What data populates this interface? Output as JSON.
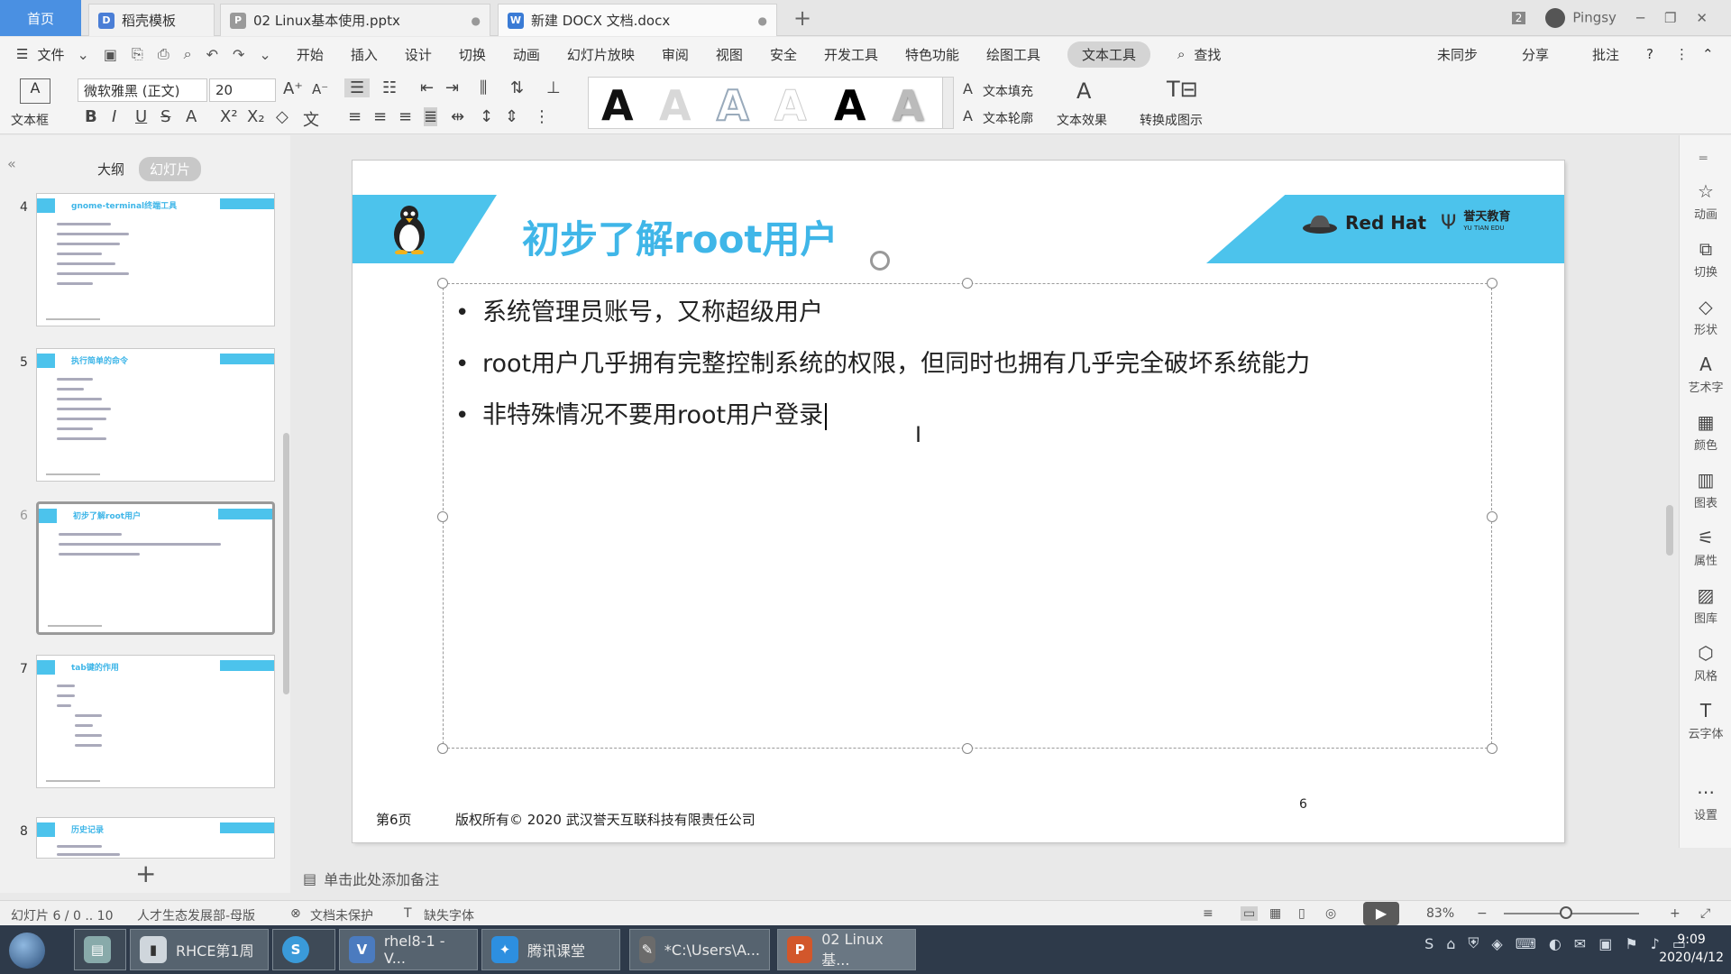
{
  "tabs": {
    "home": "首页",
    "items": [
      {
        "label": "稻壳模板",
        "icon": "docer-icon",
        "color": "#4a7ed6"
      },
      {
        "label": "02 Linux基本使用.pptx",
        "icon": "pptx-icon",
        "color": "#9a9a9a"
      },
      {
        "label": "新建 DOCX 文档.docx",
        "icon": "docx-icon",
        "color": "#3a7bd5"
      }
    ],
    "new_tab": "+"
  },
  "titlebar": {
    "badge": "2",
    "user": "Pingsy"
  },
  "menu": {
    "file": "文件",
    "items": [
      "开始",
      "插入",
      "设计",
      "切换",
      "动画",
      "幻灯片放映",
      "审阅",
      "视图",
      "安全",
      "开发工具",
      "特色功能",
      "绘图工具",
      "文本工具"
    ],
    "active": "文本工具",
    "search": "查找",
    "right": [
      "未同步",
      "分享",
      "批注"
    ]
  },
  "ribbon": {
    "textbox_label": "文本框",
    "font_name": "微软雅黑 (正文)",
    "font_size": "20",
    "text_fill": "文本填充",
    "text_outline": "文本轮廓",
    "text_effect": "文本效果",
    "convert": "转换成图示",
    "style_letter": "A"
  },
  "leftpanel": {
    "tab_outline": "大纲",
    "tab_slides": "幻灯片",
    "thumbnails": [
      {
        "num": "4",
        "title": "gnome-terminal终端工具",
        "lines": 8
      },
      {
        "num": "5",
        "title": "执行简单的命令",
        "lines": 7
      },
      {
        "num": "6",
        "title": "初步了解root用户",
        "lines": 3
      },
      {
        "num": "7",
        "title": "tab键的作用",
        "lines": 7
      },
      {
        "num": "8",
        "title": "历史记录",
        "lines": 2
      }
    ]
  },
  "slide": {
    "title": "初步了解root用户",
    "bullets": [
      "系统管理员账号，又称超级用户",
      "root用户几乎拥有完整控制系统的权限，但同时也拥有几乎完全破坏系统能力",
      "非特殊情况不要用root用户登录"
    ],
    "logo_redhat": "Red Hat",
    "logo_yutian": "誉天教育",
    "logo_yutian_en": "YU TIAN EDU",
    "footer_page": "第6页",
    "footer_copy": "版权所有© 2020 武汉誉天互联科技有限责任公司",
    "page_number": "6"
  },
  "rightbar": [
    "动画",
    "切换",
    "形状",
    "艺术字",
    "颜色",
    "图表",
    "属性",
    "图库",
    "风格",
    "云字体",
    "设置"
  ],
  "notes": "单击此处添加备注",
  "status": {
    "slide_info": "幻灯片 6 / 0 .. 10",
    "template": "人才生态发展部-母版",
    "protect": "文档未保护",
    "missing_font": "缺失字体",
    "zoom": "83%"
  },
  "taskbar": {
    "items": [
      {
        "label": "RHCE第1周",
        "color": "#cfd6dc"
      },
      {
        "label": "",
        "color": "#3a9ad9"
      },
      {
        "label": "rhel8-1 - V...",
        "color": "#4b7bbf"
      },
      {
        "label": "腾讯课堂",
        "color": "#2d8fe0"
      },
      {
        "label": "*C:\\Users\\A...",
        "color": "#6b6b6b"
      },
      {
        "label": "02 Linux基...",
        "color": "#d2572b"
      }
    ],
    "time": "9:09",
    "date": "2020/4/12"
  }
}
